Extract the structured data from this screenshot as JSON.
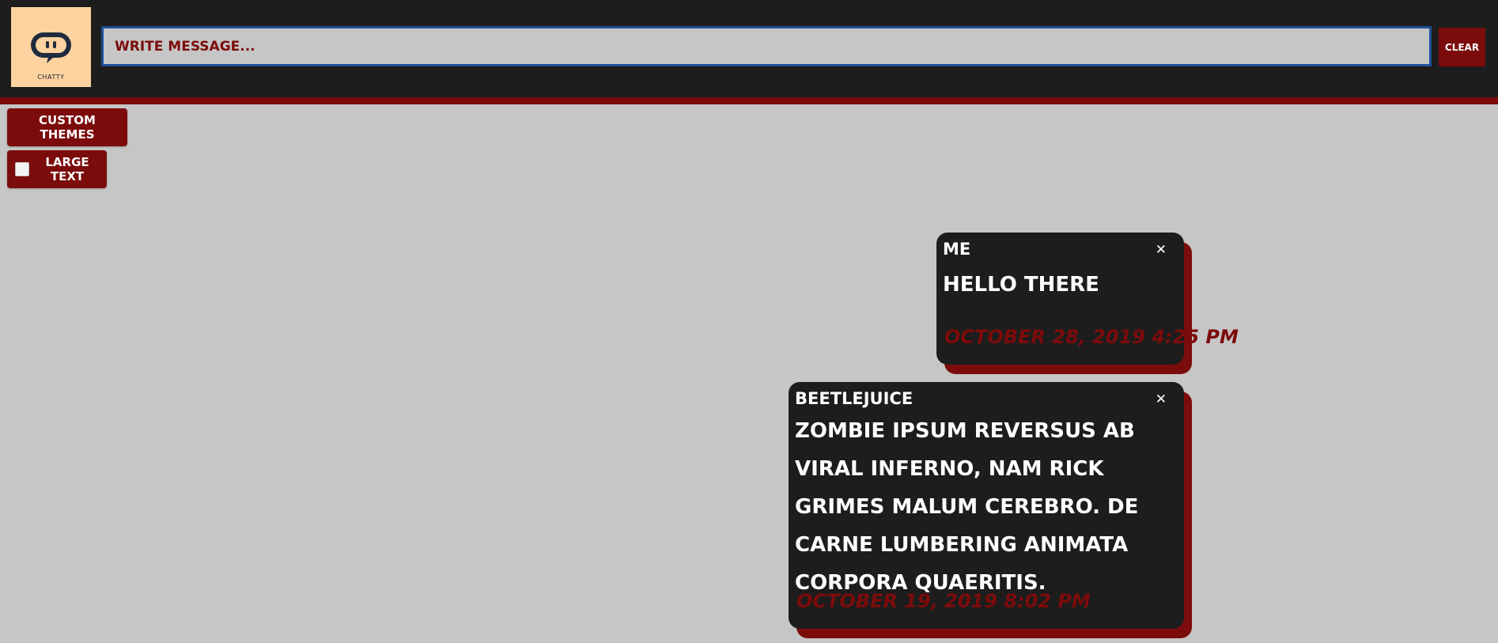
{
  "header": {
    "logo_text": "CHATTY",
    "message_placeholder": "WRITE MESSAGE...",
    "clear_label": "CLEAR"
  },
  "controls": {
    "custom_themes_label": "CUSTOM THEMES",
    "large_text_label": "LARGE TEXT",
    "large_text_checked": false
  },
  "messages": [
    {
      "sender": "ME",
      "text": "HELLO THERE",
      "timestamp": "OCTOBER 28, 2019 4:25 PM"
    },
    {
      "sender": "BEETLEJUICE",
      "text": "ZOMBIE IPSUM REVERSUS AB VIRAL INFERNO, NAM RICK GRIMES MALUM CEREBRO. DE CARNE LUMBERING ANIMATA CORPORA QUAERITIS.",
      "timestamp": "OCTOBER 19, 2019 8:02 PM"
    }
  ],
  "colors": {
    "accent": "#7c0b0b",
    "header_bg": "#1d1d1d",
    "page_bg": "#c6c6c6",
    "logo_bg": "#ffd39f",
    "input_border": "#1e4f9a"
  },
  "icons": {
    "logo": "chat-bubble-icon",
    "close": "close-icon",
    "checkbox": "checkbox-icon"
  }
}
